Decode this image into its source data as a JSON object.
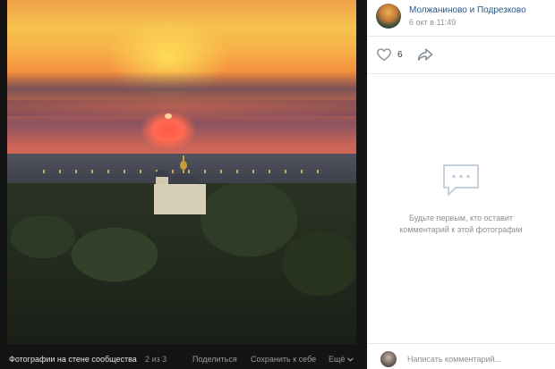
{
  "post": {
    "author": "Молжаниново и Подрезково",
    "date": "6 окт в 11:49",
    "likes_count": "6"
  },
  "comments": {
    "empty_line1": "Будьте первым, кто оставит",
    "empty_line2": "комментарий к этой фотографии",
    "input_placeholder": "Написать комментарий..."
  },
  "viewer": {
    "album_title": "Фотографии на стене сообщества",
    "counter": "2 из 3",
    "share_label": "Поделиться",
    "save_label": "Сохранить к себе",
    "more_label": "Ещё"
  },
  "icons": {
    "like": "heart-icon",
    "share": "share-arrow-icon",
    "empty_comments": "comment-bubble-icon",
    "more": "chevron-down-icon"
  },
  "colors": {
    "link": "#2a5885",
    "muted": "#939393",
    "viewer_bg": "#141414"
  }
}
